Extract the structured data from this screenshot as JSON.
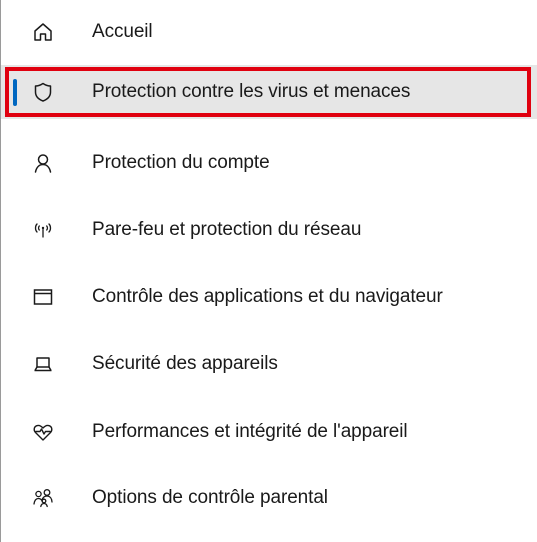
{
  "nav": {
    "items": [
      {
        "label": "Accueil",
        "icon": "home-icon"
      },
      {
        "label": "Protection contre les virus et menaces",
        "icon": "shield-icon",
        "selected": true
      },
      {
        "label": "Protection du compte",
        "icon": "person-icon"
      },
      {
        "label": "Pare-feu et protection du réseau",
        "icon": "wireless-icon"
      },
      {
        "label": "Contrôle des applications et du navigateur",
        "icon": "browser-window-icon"
      },
      {
        "label": "Sécurité des appareils",
        "icon": "laptop-icon"
      },
      {
        "label": "Performances et intégrité de l'appareil",
        "icon": "heart-pulse-icon"
      },
      {
        "label": "Options de contrôle parental",
        "icon": "family-icon"
      }
    ]
  },
  "colors": {
    "selection_frame": "#e0000f",
    "accent": "#0067c0",
    "selected_background": "#e6e6e6",
    "text": "#1a1a1a"
  }
}
